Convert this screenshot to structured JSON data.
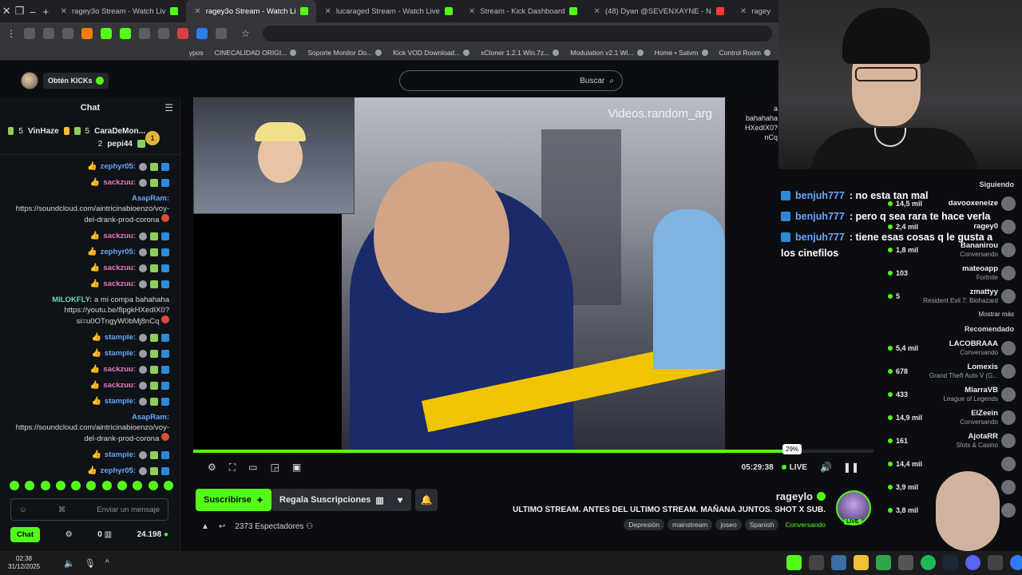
{
  "browser": {
    "tabs": [
      {
        "label": "ragey",
        "active": false
      },
      {
        "label": "(48) Dyan @SEVENXAYNE - N",
        "active": false
      },
      {
        "label": "Stream - Kick Dashboard",
        "active": false
      },
      {
        "label": "lucaraged Stream - Watch Live",
        "active": false
      },
      {
        "label": "ragey3o Stream - Watch Li",
        "active": true
      },
      {
        "label": "ragey3o Stream - Watch Liv",
        "active": false
      }
    ],
    "bookmarks": [
      "Control Room",
      "Home • Satvrn",
      "Modulation v2.1 Wi...",
      "xCloner 1.2.1 Win.7z...",
      "Kick VOD Download...",
      "Soporte Monitor Do...",
      "CINECALIDAD ORIGI...",
      "ypos"
    ]
  },
  "header": {
    "get_kicks": "Obtén KICKs",
    "search_placeholder": "Buscar"
  },
  "chat": {
    "title": "Chat",
    "pinned": [
      {
        "name": "CaraDeMon...",
        "count": "5",
        "name2": "VinHaze",
        "count2": "5"
      },
      {
        "name": "pepi44",
        "count": "2"
      }
    ],
    "messages": [
      {
        "user": "zephyr05:",
        "text": "",
        "color": "blue"
      },
      {
        "user": "sackzuu:",
        "text": "",
        "color": "pink"
      },
      {
        "user": "AsapRam:",
        "text": "https://soundcloud.com/aintricinabioenzo/voy-del-drank-prod-corona",
        "color": "blue"
      },
      {
        "user": "sackzuu:",
        "text": "",
        "color": "pink"
      },
      {
        "user": "zephyr05:",
        "text": "",
        "color": "blue"
      },
      {
        "user": "sackzuu:",
        "text": "",
        "color": "pink"
      },
      {
        "user": "sackzuu:",
        "text": "",
        "color": "pink"
      },
      {
        "user": "MILOKFLY:",
        "text": "a mi compa bahahaha https://youtu.be/8pgkHXedIX0?si=u0OTngyW0bMj8nCq",
        "color": "teal"
      },
      {
        "user": "stample:",
        "text": "",
        "color": "blue"
      },
      {
        "user": "stample:",
        "text": "",
        "color": "blue"
      },
      {
        "user": "sackzuu:",
        "text": "",
        "color": "pink"
      },
      {
        "user": "sackzuu:",
        "text": "",
        "color": "pink"
      },
      {
        "user": "stample:",
        "text": "",
        "color": "blue"
      },
      {
        "user": "AsapRam:",
        "text": "https://soundcloud.com/aintricinabioenzo/voy-del-drank-prod-corona",
        "color": "blue"
      },
      {
        "user": "stample:",
        "text": "",
        "color": "blue"
      },
      {
        "user": "zephyr05:",
        "text": "",
        "color": "blue"
      }
    ],
    "input_placeholder": "Enviar un mensaje",
    "points": "24.198",
    "gift_count": "0",
    "send_label": "Chat"
  },
  "video": {
    "watermark": "Videos.random_arg",
    "time": "05:29:38",
    "live_label": "LIVE",
    "progress_pct": 0.87,
    "tooltip": "29%"
  },
  "overlay": {
    "side_text": [
      "a",
      "bahahaha",
      "HXedIX0?",
      "nCq"
    ],
    "big_chat": [
      {
        "user": "benjuh777",
        "text": ": no esta tan mal"
      },
      {
        "user": "benjuh777",
        "text": ": pero q sea rara te hace verla"
      },
      {
        "user": "benjuh777",
        "text": ": tiene esas cosas q le gusta a"
      }
    ],
    "big_chat_cont": "los cinefilos"
  },
  "stream": {
    "subscribe_label": "Suscribirse",
    "gift_label": "Regala Suscripciones",
    "viewers": "2373 Espectadores",
    "channel": "rageylo",
    "live_badge": "LIVE",
    "title": "ULTIMO STREAM. ANTES DEL ULTIMO STREAM. MAÑANA JUNTOS. SHOT X SUB.",
    "category": "Conversando",
    "tags": [
      "Spanish",
      "joseo",
      "mainstream",
      "Depresión"
    ]
  },
  "following": {
    "header": "Siguiendo",
    "items": [
      {
        "name": "davooxeneize",
        "sub": "",
        "count": "14,5 mil"
      },
      {
        "name": "ragey0",
        "sub": "",
        "count": "2,4 mil"
      },
      {
        "name": "Bananirou",
        "sub": "Conversando",
        "count": "1,8 mil"
      },
      {
        "name": "mateoapp",
        "sub": "Fortnite",
        "count": "103"
      },
      {
        "name": "zmattyy",
        "sub": "Resident Evil 7: Biohazard",
        "count": "5"
      }
    ],
    "show_more": "Mostrar más",
    "recommended_header": "Recomendado",
    "recommended": [
      {
        "name": "LACOBRAAA",
        "sub": "Conversando",
        "count": "5,4 mil"
      },
      {
        "name": "Lomexis",
        "sub": "Grand Theft Auto V (G...",
        "count": "678"
      },
      {
        "name": "MiarraVB",
        "sub": "League of Legends",
        "count": "433"
      },
      {
        "name": "ElZeein",
        "sub": "Conversando",
        "count": "14,9 mil"
      },
      {
        "name": "AjotaRR",
        "sub": "Slots & Casino",
        "count": "161"
      },
      {
        "name": "",
        "sub": "",
        "count": "14,4 mil"
      },
      {
        "name": "",
        "sub": "",
        "count": "3,9 mil"
      },
      {
        "name": "",
        "sub": "",
        "count": "3,8 mil"
      }
    ]
  },
  "taskbar": {
    "time": "02:38",
    "date": "31/12/2025"
  }
}
